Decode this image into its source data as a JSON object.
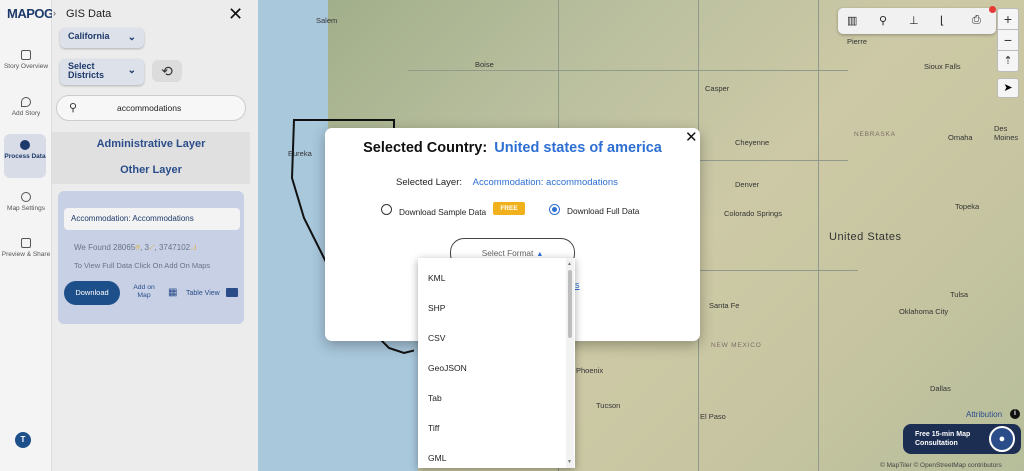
{
  "brand": {
    "logo": "MAPOG"
  },
  "rail": {
    "items": [
      {
        "label": "Story Overview"
      },
      {
        "label": "Add Story"
      },
      {
        "label": "Process Data"
      },
      {
        "label": "Map Settings"
      },
      {
        "label": "Preview & Share"
      }
    ],
    "avatar": "T"
  },
  "panel": {
    "title": "GIS Data",
    "state": "California",
    "district": "Select Districts",
    "search_value": "accommodations",
    "layers": [
      "Administrative Layer",
      "Other Layer"
    ],
    "card": {
      "title": "Accommodation: Accommodations",
      "found_prefix": "We Found",
      "count_a": "28065",
      "count_b": "3",
      "count_c": "3747102",
      "hint": "To View Full Data Click On Add On Maps",
      "download": "Download",
      "add_on_map": "Add on Map",
      "table_view": "Table View"
    }
  },
  "map": {
    "cities": [
      "Salem",
      "Boise",
      "Pierre",
      "Sioux Falls",
      "Casper",
      "Eureka",
      "Cheyenne",
      "NEBRASKA",
      "Omaha",
      "Des Moines",
      "Denver",
      "Colorado Springs",
      "Topeka",
      "United States",
      "Santa Fe",
      "NEW MEXICO",
      "Oklahoma City",
      "Phoenix",
      "Tucson",
      "El Paso",
      "Dallas",
      "Tulsa"
    ],
    "attribution": "Attribution",
    "copyright": "© MapTiler © OpenStreetMap contributors",
    "consult": "Free 15-min Map Consultation"
  },
  "modal": {
    "title_prefix": "Selected Country:",
    "country": "United states of america",
    "layer_label": "Selected Layer:",
    "layer_value": "Accommodation: accommodations",
    "option_sample": "Download Sample Data",
    "free_badge": "FREE",
    "option_full": "Download Full Data",
    "format_placeholder": "Select Format",
    "link_fragment": "es",
    "formats": [
      "KML",
      "SHP",
      "CSV",
      "GeoJSON",
      "Tab",
      "Tiff",
      "GML"
    ]
  }
}
